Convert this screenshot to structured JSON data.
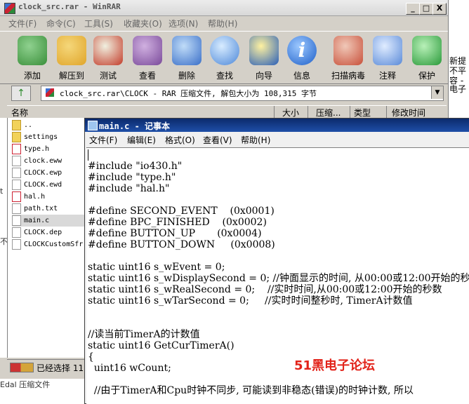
{
  "winrar": {
    "title": "clock_src.rar - WinRAR",
    "window_buttons": [
      "_",
      "□",
      "X"
    ],
    "menu": [
      "文件(F)",
      "命令(C)",
      "工具(S)",
      "收藏夹(O)",
      "选项(N)",
      "帮助(H)"
    ],
    "toolbar": [
      {
        "label": "添加",
        "icon": "add-books-icon",
        "color": "#3a8f3a"
      },
      {
        "label": "解压到",
        "icon": "extract-folder-icon",
        "color": "#e0a52a"
      },
      {
        "label": "测试",
        "icon": "test-clipboard-icon",
        "color": "#c33c2a"
      },
      {
        "label": "查看",
        "icon": "view-books-icon",
        "color": "#7a4a9a"
      },
      {
        "label": "删除",
        "icon": "delete-bin-icon",
        "color": "#3a6fc8"
      },
      {
        "label": "查找",
        "icon": "find-magnifier-icon",
        "color": "#4a86d8"
      },
      {
        "label": "向导",
        "icon": "wizard-star-icon",
        "color": "#2a5fb8"
      },
      {
        "label": "信息",
        "icon": "info-icon",
        "color": "#1e5fc8"
      },
      {
        "label": "扫描病毒",
        "icon": "scan-doctor-icon",
        "color": "#c8503a"
      },
      {
        "label": "注释",
        "icon": "comment-pen-icon",
        "color": "#5a8ad8"
      },
      {
        "label": "保护",
        "icon": "protect-shield-icon",
        "color": "#2a9a3a"
      }
    ],
    "address": "clock_src.rar\\CLOCK - RAR 压缩文件, 解包大小为 108,315 字节",
    "up_icon": "↑",
    "columns": [
      "名称",
      "大小",
      "压缩...",
      "类型",
      "修改时间"
    ],
    "files": [
      {
        "name": "..",
        "kind": "folder"
      },
      {
        "name": "settings",
        "kind": "folder"
      },
      {
        "name": "type.h",
        "kind": "h"
      },
      {
        "name": "clock.eww",
        "kind": "doc"
      },
      {
        "name": "CLOCK.ewp",
        "kind": "doc"
      },
      {
        "name": "CLOCK.ewd",
        "kind": "doc"
      },
      {
        "name": "hal.h",
        "kind": "h"
      },
      {
        "name": "path.txt",
        "kind": "doc"
      },
      {
        "name": "main.c",
        "kind": "doc",
        "selected": true
      },
      {
        "name": "CLOCK.dep",
        "kind": "doc"
      },
      {
        "name": "CLOCKCustomSfr",
        "kind": "doc"
      }
    ],
    "status": "已经选择 11",
    "under_text": "Edal 压缩文件"
  },
  "right_fragments": [
    "新提",
    "不平",
    "容 -",
    "电子"
  ],
  "left_fragments": [
    "t",
    "不"
  ],
  "notepad": {
    "title": "main.c - 记事本",
    "menu": [
      "文件(F)",
      "编辑(E)",
      "格式(O)",
      "查看(V)",
      "帮助(H)"
    ],
    "lines": [
      "",
      "#include \"io430.h\"",
      "#include \"type.h\"",
      "#include \"hal.h\"",
      "",
      "#define SECOND_EVENT    (0x0001)",
      "#define BPC_FINISHED    (0x0002)",
      "#define BUTTON_UP       (0x0004)",
      "#define BUTTON_DOWN     (0x0008)",
      "",
      "static uint16 s_wEvent = 0;",
      "static uint16 s_wDisplaySecond = 0; //钟面显示的时间, 从00:00或12:00开始的秒",
      "static uint16 s_wRealSecond = 0;    //实时时间,从00:00或12:00开始的秒数",
      "static uint16 s_wTarSecond = 0;     //实时时间整秒时, TimerA计数值",
      "",
      "",
      "//读当前TimerA的计数值",
      "static uint16 GetCurTimerA()",
      "{",
      "  uint16 wCount;",
      "",
      "  //由于TimerA和Cpu时钟不同步, 可能读到非稳态(错误)的时钟计数, 所以"
    ],
    "watermark": "51黑电子论坛"
  }
}
